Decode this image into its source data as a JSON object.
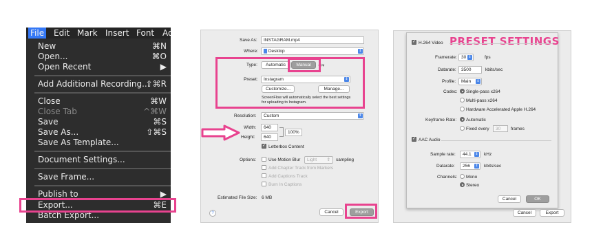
{
  "menu": {
    "menubar": [
      "File",
      "Edit",
      "Mark",
      "Insert",
      "Font",
      "Ad"
    ],
    "items": [
      {
        "label": "New",
        "shortcut": "⌘N"
      },
      {
        "label": "Open...",
        "shortcut": "⌘O"
      },
      {
        "label": "Open Recent",
        "shortcut": "▶"
      },
      {
        "label": "Add Additional Recording...",
        "shortcut": "⇧⌘R"
      },
      {
        "label": "Close",
        "shortcut": "⌘W"
      },
      {
        "label": "Close Tab",
        "shortcut": "^⌘W"
      },
      {
        "label": "Save",
        "shortcut": "⌘S"
      },
      {
        "label": "Save As...",
        "shortcut": "⇧⌘S"
      },
      {
        "label": "Save As Template...",
        "shortcut": ""
      },
      {
        "label": "Document Settings...",
        "shortcut": ""
      },
      {
        "label": "Save Frame...",
        "shortcut": ""
      },
      {
        "label": "Publish to",
        "shortcut": "▶"
      },
      {
        "label": "Export...",
        "shortcut": "⌘E"
      },
      {
        "label": "Batch Export...",
        "shortcut": ""
      }
    ]
  },
  "export": {
    "save_as_label": "Save As:",
    "save_as_value": "INSTAGRAM.mp4",
    "where_label": "Where:",
    "where_value": "Desktop",
    "type_label": "Type:",
    "type_automatic": "Automatic",
    "type_manual": "Manual",
    "preset_label": "Preset:",
    "preset_value": "Instagram",
    "customize_button": "Customize...",
    "manage_button": "Manage...",
    "preset_note_1": "ScreenFlow will automatically select the best settings",
    "preset_note_2": "for uploading to Instagram.",
    "resolution_label": "Resolution:",
    "resolution_value": "Custom",
    "width_label": "Width:",
    "width_value": "640",
    "height_label": "Height:",
    "height_value": "640",
    "scale_value": "100%",
    "letterbox_label": "Letterbox Content",
    "options_label": "Options:",
    "motion_blur_label": "Use Motion Blur",
    "motion_blur_value": "Light",
    "sampling_label": "sampling",
    "chapter_track_label": "Add Chapter Track from Markers",
    "captions_track_label": "Add Captions Track",
    "burn_captions_label": "Burn In Captions",
    "file_size_label": "Estimated File Size:",
    "file_size_value": "6 MB",
    "help_glyph": "?",
    "cancel_button": "Cancel",
    "export_button": "Export"
  },
  "preset": {
    "title": "PRESET SETTINGS",
    "video_section": "H.264 Video",
    "framerate_label": "Framerate:",
    "framerate_value": "30",
    "framerate_unit": "fps",
    "datarate_label": "Datarate:",
    "datarate_value": "3500",
    "datarate_unit": "kbits/sec",
    "profile_label": "Profile:",
    "profile_value": "Main",
    "codec_label": "Codec:",
    "codec_single": "Single-pass x264",
    "codec_multi": "Multi-pass x264",
    "codec_hw": "Hardware Accelerated Apple H.264",
    "keyframe_label": "Keyframe Rate:",
    "keyframe_auto": "Automatic",
    "keyframe_fixed": "Fixed every",
    "keyframe_fixed_value": "30",
    "keyframe_unit": "frames",
    "audio_section": "AAC Audio",
    "sample_rate_label": "Sample rate:",
    "sample_rate_value": "44.1",
    "sample_rate_unit": "kHz",
    "audio_datarate_label": "Datarate:",
    "audio_datarate_value": "256",
    "audio_datarate_unit": "kbits/sec",
    "channels_label": "Channels:",
    "channels_mono": "Mono",
    "channels_stereo": "Stereo",
    "cancel_button": "Cancel",
    "ok_button": "OK",
    "outer_cancel_button": "Cancel",
    "outer_export_button": "Export"
  },
  "colors": {
    "highlight": "#e8438f",
    "menu_bg": "#2d2d2d",
    "menu_active": "#3478f6",
    "dialog_bg": "#ececec"
  }
}
